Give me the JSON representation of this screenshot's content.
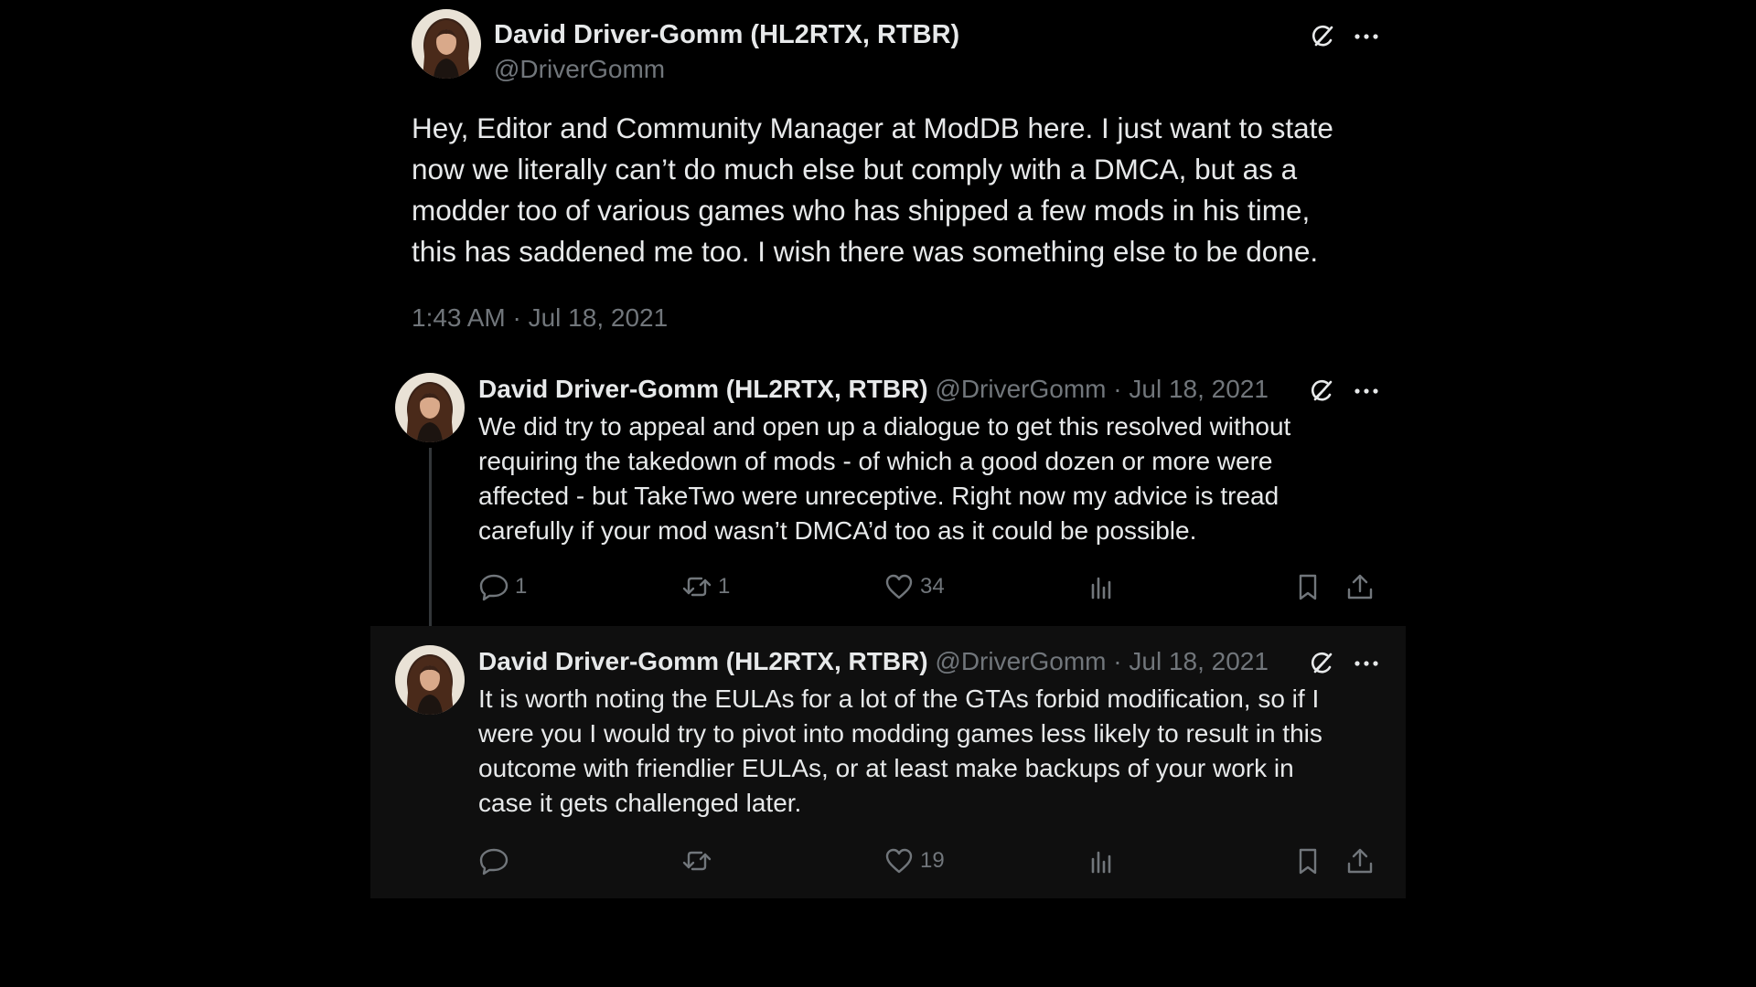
{
  "main_tweet": {
    "author_name": "David Driver-Gomm (HL2RTX, RTBR)",
    "author_handle": "@DriverGomm",
    "text": "Hey, Editor and Community Manager at ModDB here. I just want to state\nnow we literally can’t do much else but comply with a DMCA, but as a\nmodder too of various games who has shipped a few mods in his time,\nthis has saddened me too. I wish there was something else to be done.",
    "timestamp": "1:43 AM · Jul 18, 2021",
    "icons": [
      "grok-icon",
      "more-icon"
    ]
  },
  "replies": [
    {
      "author_name": "David Driver-Gomm (HL2RTX, RTBR)",
      "meta": "@DriverGomm · Jul 18, 2021",
      "text": "We did try to appeal and open up a dialogue to get this resolved without\nrequiring the takedown of mods - of which a good dozen or more were\naffected - but TakeTwo were unreceptive. Right now my advice is tread\ncarefully if your mod wasn’t DMCA’d too as it could be possible.",
      "replies_count": "1",
      "reposts_count": "1",
      "likes_count": "34"
    },
    {
      "author_name": "David Driver-Gomm (HL2RTX, RTBR)",
      "meta": "@DriverGomm · Jul 18, 2021",
      "text": "It is worth noting the EULAs for a lot of the GTAs forbid modification, so if I\nwere you I would try to pivot into modding games less likely to result in this\noutcome with friendlier EULAs, or at least make backups of your work in\ncase it gets challenged later.",
      "replies_count": "",
      "reposts_count": "",
      "likes_count": "19"
    }
  ],
  "colors": {
    "background": "#000000",
    "text_primary": "#e7e9ea",
    "text_secondary": "#71767b",
    "highlight_row": "#0f0f0f",
    "thread_line": "#333639"
  }
}
